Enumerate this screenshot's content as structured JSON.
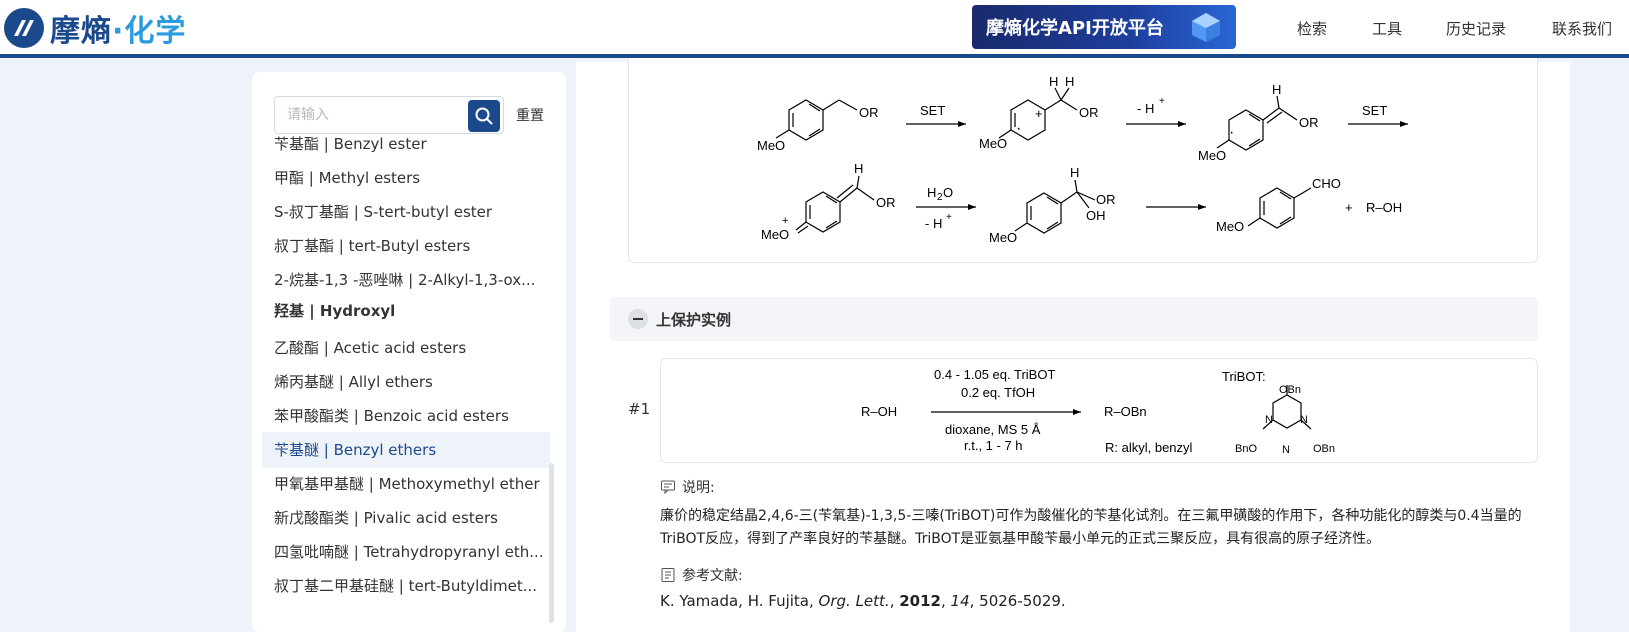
{
  "header": {
    "logo_text": "摩熵",
    "logo_dot": "·",
    "logo_accent": "化学",
    "banner": "摩熵化学API开放平台",
    "nav": [
      "检索",
      "工具",
      "历史记录",
      "联系我们"
    ]
  },
  "sidebar": {
    "search_placeholder": "请输入",
    "reset": "重置",
    "items": [
      {
        "label": "苄基酯 | Benzyl ester",
        "group": false,
        "active": false
      },
      {
        "label": "甲酯 | Methyl esters",
        "group": false,
        "active": false
      },
      {
        "label": "S-叔丁基酯 | S-tert-butyl ester",
        "group": false,
        "active": false
      },
      {
        "label": "叔丁基酯 | tert-Butyl esters",
        "group": false,
        "active": false
      },
      {
        "label": "2-烷基-1,3 -恶唑啉 | 2-Alkyl-1,3-ox...",
        "group": false,
        "active": false
      },
      {
        "label": "羟基 | Hydroxyl",
        "group": true,
        "active": false
      },
      {
        "label": "乙酸酯 | Acetic acid esters",
        "group": false,
        "active": false
      },
      {
        "label": "烯丙基醚 | Allyl ethers",
        "group": false,
        "active": false
      },
      {
        "label": "苯甲酸酯类 | Benzoic acid esters",
        "group": false,
        "active": false
      },
      {
        "label": "苄基醚 | Benzyl ethers",
        "group": false,
        "active": true
      },
      {
        "label": "甲氧基甲基醚 | Methoxymethyl ether",
        "group": false,
        "active": false
      },
      {
        "label": "新戊酸酯类 | Pivalic acid esters",
        "group": false,
        "active": false
      },
      {
        "label": "四氢吡喃醚 | Tetrahydropyranyl eth...",
        "group": false,
        "active": false
      },
      {
        "label": "叔丁基二甲基硅醚 | tert-Butyldimet...",
        "group": false,
        "active": false
      }
    ]
  },
  "mechanism": {
    "set": "SET",
    "minus_h": "- H",
    "plus": "+",
    "h2o_h": "H",
    "h2o_2": "2",
    "h2o_o": "O",
    "meo": "MeO",
    "or": "OR",
    "h": "H",
    "oh": "OH",
    "cho": "CHO",
    "roh": "R–OH",
    "dot": "·"
  },
  "section": {
    "title": "上保护实例"
  },
  "example": {
    "number": "#1",
    "reagent_line1": "0.4 - 1.05 eq. TriBOT",
    "reagent_line2": "0.2 eq. TfOH",
    "condition_line1": "dioxane, MS 5 Å",
    "condition_line2": "r.t., 1 - 7 h",
    "reactant": "R–OH",
    "product": "R–OBn",
    "r_groups": "R: alkyl, benzyl",
    "tribot_label": "TriBOT:",
    "obn": "OBn",
    "bno": "BnO",
    "n": "N",
    "note_label": "说明:",
    "note": "廉价的稳定结晶2,4,6-三(苄氧基)-1,3,5-三嗪(TriBOT)可作为酸催化的苄基化试剂。在三氟甲磺酸的作用下，各种功能化的醇类与0.4当量的TriBOT反应，得到了产率良好的苄基醚。TriBOT是亚氨基甲酸苄最小单元的正式三聚反应，具有很高的原子经济性。",
    "ref_label": "参考文献:",
    "ref_authors": "K. Yamada, H. Fujita, ",
    "ref_journal": "Org. Lett.",
    "ref_sep1": ", ",
    "ref_year": "2012",
    "ref_sep2": ", ",
    "ref_volume": "14",
    "ref_pages": ", 5026-5029."
  }
}
